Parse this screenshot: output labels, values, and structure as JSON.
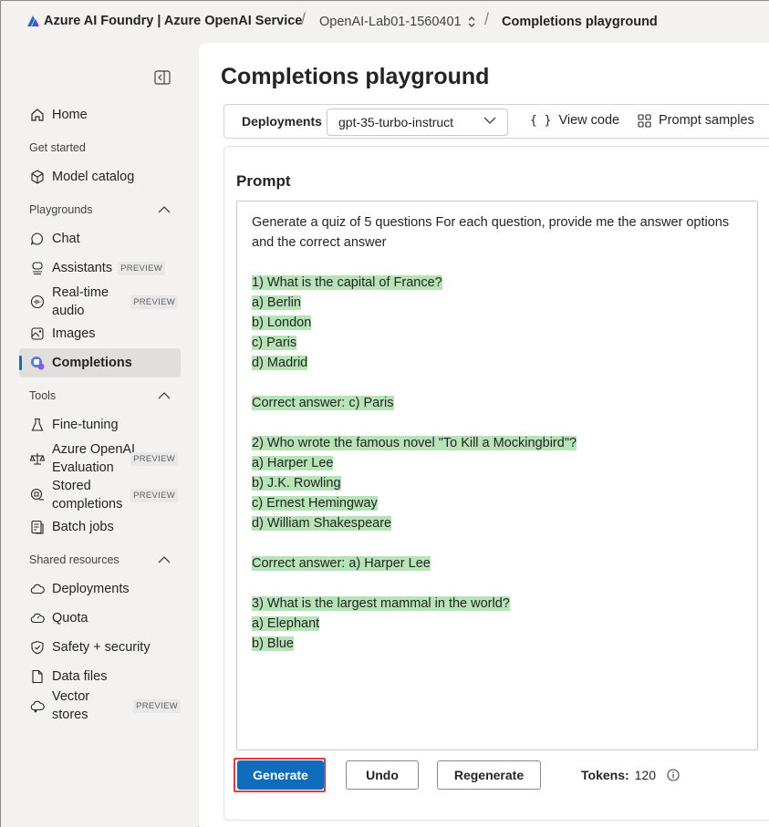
{
  "header": {
    "brand": "Azure AI Foundry | Azure OpenAI Service",
    "project": "OpenAI-Lab01-1560401",
    "current_page": "Completions playground"
  },
  "sidebar": {
    "items": [
      {
        "label": "Home",
        "icon": "home-icon"
      },
      {
        "section": "Get started"
      },
      {
        "label": "Model catalog",
        "icon": "cube-icon"
      },
      {
        "section": "Playgrounds"
      },
      {
        "label": "Chat",
        "icon": "chat-icon"
      },
      {
        "label": "Assistants",
        "icon": "assistant-icon",
        "badge": "PREVIEW"
      },
      {
        "label": "Real-time audio",
        "icon": "audio-icon",
        "badge": "PREVIEW"
      },
      {
        "label": "Images",
        "icon": "image-icon"
      },
      {
        "label": "Completions",
        "icon": "completions-icon",
        "active": true
      },
      {
        "section": "Tools"
      },
      {
        "label": "Fine-tuning",
        "icon": "flask-icon"
      },
      {
        "label": "Azure OpenAI Evaluation",
        "icon": "scale-icon",
        "badge": "PREVIEW"
      },
      {
        "label": "Stored completions",
        "icon": "stored-icon",
        "badge": "PREVIEW"
      },
      {
        "label": "Batch jobs",
        "icon": "batch-icon"
      },
      {
        "section": "Shared resources"
      },
      {
        "label": "Deployments",
        "icon": "cloud-icon"
      },
      {
        "label": "Quota",
        "icon": "quota-icon"
      },
      {
        "label": "Safety + security",
        "icon": "shield-icon"
      },
      {
        "label": "Data files",
        "icon": "file-icon"
      },
      {
        "label": "Vector stores",
        "icon": "vector-icon",
        "badge": "PREVIEW"
      }
    ],
    "labels": {
      "home": "Home",
      "get_started": "Get started",
      "model_catalog": "Model catalog",
      "playgrounds": "Playgrounds",
      "chat": "Chat",
      "assistants": "Assistants",
      "realtime_1": "Real-time",
      "realtime_2": "audio",
      "images": "Images",
      "completions": "Completions",
      "tools": "Tools",
      "fine_tuning": "Fine-tuning",
      "eval_1": "Azure OpenAI",
      "eval_2": "Evaluation",
      "stored_1": "Stored",
      "stored_2": "completions",
      "batch_jobs": "Batch jobs",
      "shared_resources": "Shared resources",
      "deployments": "Deployments",
      "quota": "Quota",
      "safety": "Safety + security",
      "data_files": "Data files",
      "vector_stores": "Vector stores",
      "preview": "PREVIEW"
    }
  },
  "main": {
    "title": "Completions playground",
    "toolbar": {
      "deployments_label": "Deployments",
      "deployment_value": "gpt-35-turbo-instruct",
      "view_code": "View code",
      "prompt_samples": "Prompt samples"
    },
    "prompt": {
      "label": "Prompt",
      "intro": "Generate a quiz of 5 questions For each question, provide me the answer options and the correct answer",
      "generated_lines": [
        "",
        "1) What is the capital of France?",
        "a) Berlin",
        "b) London",
        "c) Paris",
        "d) Madrid",
        "",
        "Correct answer: c) Paris",
        "",
        "2) Who wrote the famous novel \"To Kill a Mockingbird\"?",
        "a) Harper Lee",
        "b) J.K. Rowling",
        "c) Ernest Hemingway",
        "d) William Shakespeare",
        "",
        "Correct answer: a) Harper Lee",
        "",
        "3) What is the largest mammal in the world?",
        "a) Elephant",
        "b) Blue"
      ]
    },
    "actions": {
      "generate": "Generate",
      "undo": "Undo",
      "regenerate": "Regenerate",
      "tokens_label": "Tokens:",
      "tokens_value": "120"
    }
  },
  "colors": {
    "accent": "#0f6cbd",
    "highlight": "#b7e4b7",
    "focus_frame": "#e0393e"
  }
}
